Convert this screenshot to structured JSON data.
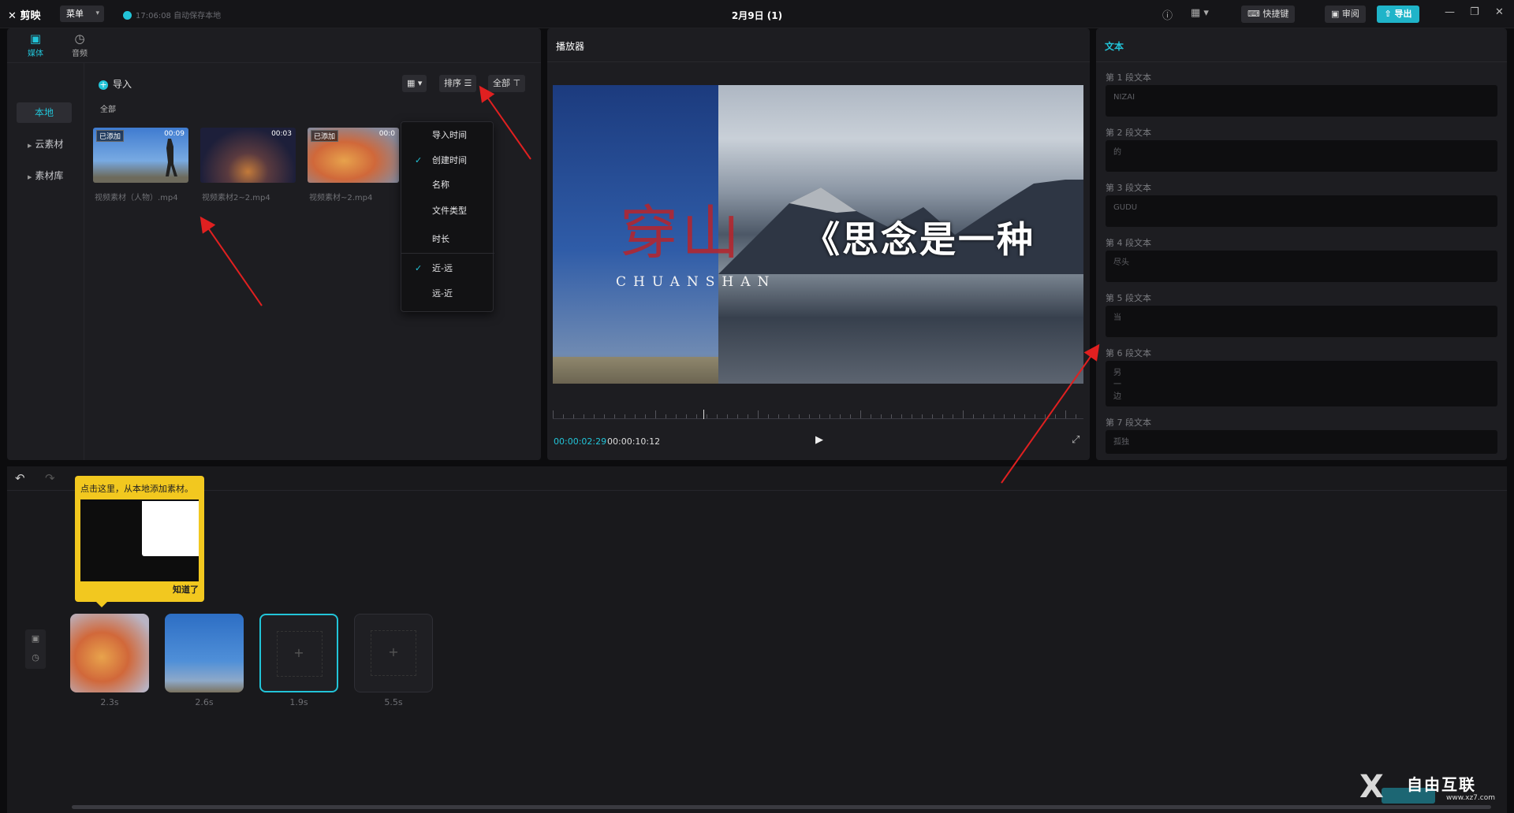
{
  "app": {
    "logo": "剪映",
    "menu_label": "菜单",
    "autosave": "17:06:08 自动保存本地",
    "doc_title": "2月9日 (1)",
    "shortcut_label": "快捷键",
    "review_label": "审阅",
    "export_label": "导出"
  },
  "media": {
    "tabs": [
      {
        "label": "媒体",
        "icon": "media-icon"
      },
      {
        "label": "音频",
        "icon": "audio-icon"
      }
    ],
    "side_items": [
      "本地",
      "云素材",
      "素材库"
    ],
    "import_label": "导入",
    "all_label": "全部",
    "sort_label": "排序",
    "filter_label": "全部",
    "items": [
      {
        "name": "视频素材（人物）.mp4",
        "duration": "00:09",
        "added": "已添加"
      },
      {
        "name": "视频素材2~2.mp4",
        "duration": "00:03",
        "added": ""
      },
      {
        "name": "视频素材~2.mp4",
        "duration": "00:0",
        "added": "已添加"
      }
    ]
  },
  "sort_menu": {
    "items": [
      "导入时间",
      "创建时间",
      "名称",
      "文件类型",
      "时长",
      "近-远",
      "远-近"
    ],
    "checked": [
      "创建时间",
      "近-远"
    ]
  },
  "player": {
    "title": "播放器",
    "overlay_title": "穿山",
    "overlay_sub": "CHUANSHAN",
    "overlay_right": "《思念是一种",
    "current_time": "00:00:02:29",
    "total_time": "00:00:10:12"
  },
  "text_panel": {
    "title": "文本",
    "segments": [
      {
        "label": "第 1 段文本",
        "value": "NIZAI"
      },
      {
        "label": "第 2 段文本",
        "value": "的"
      },
      {
        "label": "第 3 段文本",
        "value": "GUDU"
      },
      {
        "label": "第 4 段文本",
        "value": "尽头"
      },
      {
        "label": "第 5 段文本",
        "value": "当"
      },
      {
        "label": "第 6 段文本",
        "value": "另\n一\n边"
      },
      {
        "label": "第 7 段文本",
        "value": "孤独"
      }
    ]
  },
  "timeline": {
    "tooltip_text": "点击这里，从本地添加素材。",
    "tooltip_button": "知道了",
    "clips": [
      {
        "duration": "2.3s",
        "type": "image"
      },
      {
        "duration": "2.6s",
        "type": "image"
      },
      {
        "duration": "1.9s",
        "type": "empty-selected"
      },
      {
        "duration": "5.5s",
        "type": "empty"
      }
    ]
  },
  "watermark": {
    "text": "自由互联",
    "sub": "www.xz7.com"
  },
  "colors": {
    "accent": "#22c4d8",
    "tooltip": "#f2c81f",
    "annotation_arrow": "#e02020"
  }
}
